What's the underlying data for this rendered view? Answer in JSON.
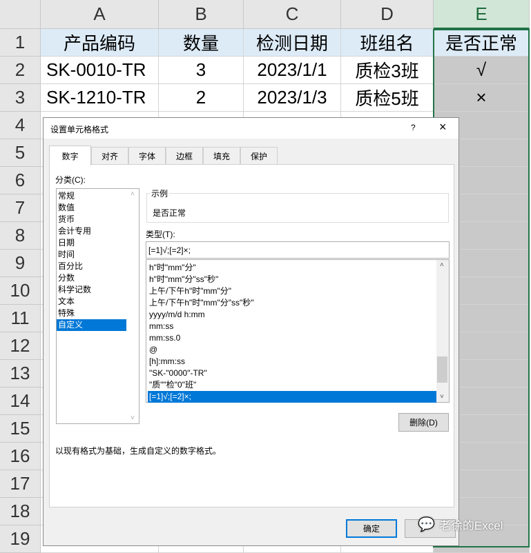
{
  "columns": [
    "A",
    "B",
    "C",
    "D",
    "E"
  ],
  "rows": [
    "1",
    "2",
    "3",
    "4",
    "5",
    "6",
    "7",
    "8",
    "9",
    "10",
    "11",
    "12",
    "13",
    "14",
    "15",
    "16",
    "17",
    "18",
    "19"
  ],
  "table": {
    "header": [
      "产品编码",
      "数量",
      "检测日期",
      "班组名",
      "是否正常"
    ],
    "data": [
      [
        "SK-0010-TR",
        "3",
        "2023/1/1",
        "质检3班",
        "√"
      ],
      [
        "SK-1210-TR",
        "2",
        "2023/1/3",
        "质检5班",
        "×"
      ]
    ]
  },
  "dialog": {
    "title": "设置单元格格式",
    "help": "?",
    "close": "×",
    "tabs": [
      "数字",
      "对齐",
      "字体",
      "边框",
      "填充",
      "保护"
    ],
    "category_label": "分类(C):",
    "categories": [
      "常规",
      "数值",
      "货币",
      "会计专用",
      "日期",
      "时间",
      "百分比",
      "分数",
      "科学记数",
      "文本",
      "特殊",
      "自定义"
    ],
    "sample_label": "示例",
    "sample_value": "是否正常",
    "type_label": "类型(T):",
    "type_value": "[=1]√;[=2]×;",
    "formats": [
      "h\"时\"mm\"分\"",
      "h\"时\"mm\"分\"ss\"秒\"",
      "上午/下午h\"时\"mm\"分\"",
      "上午/下午h\"时\"mm\"分\"ss\"秒\"",
      "yyyy/m/d h:mm",
      "mm:ss",
      "mm:ss.0",
      "@",
      "[h]:mm:ss",
      "\"SK-\"0000\"-TR\"",
      "\"质\"\"检\"0\"班\"",
      "[=1]√;[=2]×;"
    ],
    "delete_label": "删除(D)",
    "description": "以现有格式为基础，生成自定义的数字格式。",
    "ok_label": "确定"
  },
  "watermark": "老徐的Excel"
}
